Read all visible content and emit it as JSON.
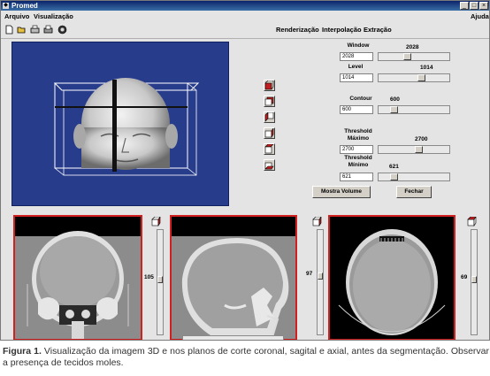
{
  "window": {
    "title": "Promed",
    "controls": [
      "_",
      "□",
      "×"
    ]
  },
  "menu": {
    "left": [
      "Arquivo",
      "Visualização"
    ],
    "right": "Ajuda"
  },
  "toolbar": {
    "icons": [
      "new-file-icon",
      "open-file-icon",
      "print-icon",
      "print-preview-icon",
      "exit-icon"
    ],
    "menus": [
      "Renderização",
      "Interpolação",
      "Extração"
    ]
  },
  "render_view": {
    "background": "#283c8c"
  },
  "controls": {
    "window": {
      "label": "Window",
      "display": "2028",
      "field": "2028",
      "level_fraction": 0.4
    },
    "level": {
      "label": "Level",
      "display": "1014",
      "field": "1014",
      "level_fraction": 0.62
    },
    "contour": {
      "label": "Contour",
      "display": "600",
      "field": "600",
      "level_fraction": 0.18
    },
    "threshold_max": {
      "label_lines": [
        "Threshold",
        "Máximo"
      ],
      "display": "2700",
      "field": "2700",
      "level_fraction": 0.58
    },
    "threshold_min": {
      "label_lines": [
        "Threshold",
        "Mínimo"
      ],
      "display": "621",
      "field": "621",
      "level_fraction": 0.18
    }
  },
  "buttons": {
    "show_volume": "Mostra Volume",
    "close": "Fechar"
  },
  "slices": {
    "coronal": {
      "value": "105"
    },
    "sagittal": {
      "value": "97"
    },
    "axial": {
      "value": "69"
    }
  },
  "caption": {
    "label": "Figura 1.",
    "text": " Visualização da imagem 3D e nos planos de corte coronal, sagital e axial, antes da segmentação. Observar a presença de tecidos moles."
  },
  "colors": {
    "accent": "#d02020",
    "title_bar": "#0a246a"
  }
}
